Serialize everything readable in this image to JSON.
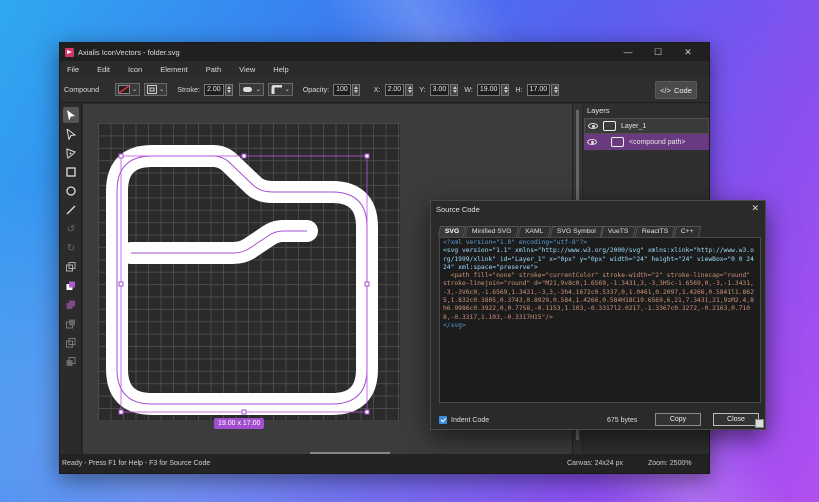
{
  "window": {
    "title": "Axialis IconVectors - folder.svg",
    "controls": [
      "—",
      "☐",
      "✕"
    ]
  },
  "menu": [
    "File",
    "Edit",
    "Icon",
    "Element",
    "Path",
    "View",
    "Help"
  ],
  "toolbar": {
    "mode_label": "Compound",
    "stroke_label": "Stroke:",
    "stroke_value": "2.00",
    "opacity_label": "Opacity:",
    "opacity_value": "100",
    "x_label": "X:",
    "x_value": "2.00",
    "y_label": "Y:",
    "y_value": "3.00",
    "w_label": "W:",
    "w_value": "19.00",
    "h_label": "H:",
    "h_value": "17.00",
    "code_button": "Code"
  },
  "canvas": {
    "size_badge": "19.00 x 17.00"
  },
  "layers": {
    "title": "Layers",
    "items": [
      {
        "label": "Layer_1"
      },
      {
        "label": "<compound path>"
      }
    ]
  },
  "status": {
    "help": "Ready - Press F1 for Help - F3 for Source Code",
    "canvas_size": "Canvas: 24x24 px",
    "zoom": "Zoom: 2500%"
  },
  "source_dialog": {
    "title": "Source Code",
    "close": "✕",
    "tabs": [
      "SVG",
      "Minified SVG",
      "XAML",
      "SVG Symbol",
      "VueTS",
      "ReactTS",
      "C++"
    ],
    "active_tab": "SVG",
    "code": {
      "line1": "<?xml version=\"1.0\" encoding=\"utf-8\"?>",
      "line2": "<svg version=\"1.1\" xmlns=\"http://www.w3.org/2000/svg\" xmlns:xlink=\"http://www.w3.org/1999/xlink\" id=\"Layer_1\" x=\"0px\" y=\"0px\" width=\"24\" height=\"24\" viewBox=\"0 0 24 24\" xml:space=\"preserve\">",
      "line3": "  <path fill=\"none\" stroke=\"currentColor\" stroke-width=\"2\" stroke-linecap=\"round\" stroke-linejoin=\"round\" d=\"M21,9v8c0,1.6569,-1.3431,3,-3,3H5c-1.6569,0,-3,-1.3431,-3,-3V6c0,-1.6569,1.3431,-3,3,-3h4.1672c0.5337,0,1.0461,0.2097,1.4266,0.5841l1.8625,1.832c0.3805,0.3743,0.8929,0.584,1.4266,0.584H18C19.6569,6,21,7.3431,21,9zM2.4,8h6.9986c0.3922,0,0.7758,-0.1153,1.103,-0.3317l2.0217,-1.3367c0.3272,-0.2163,0.7108,-0.3317,1.103,-0.3317H15\"/>",
      "line4": "</svg>"
    },
    "indent_label": "Indent Code",
    "bytes": "675 bytes",
    "copy_button": "Copy",
    "close_button": "Close"
  }
}
